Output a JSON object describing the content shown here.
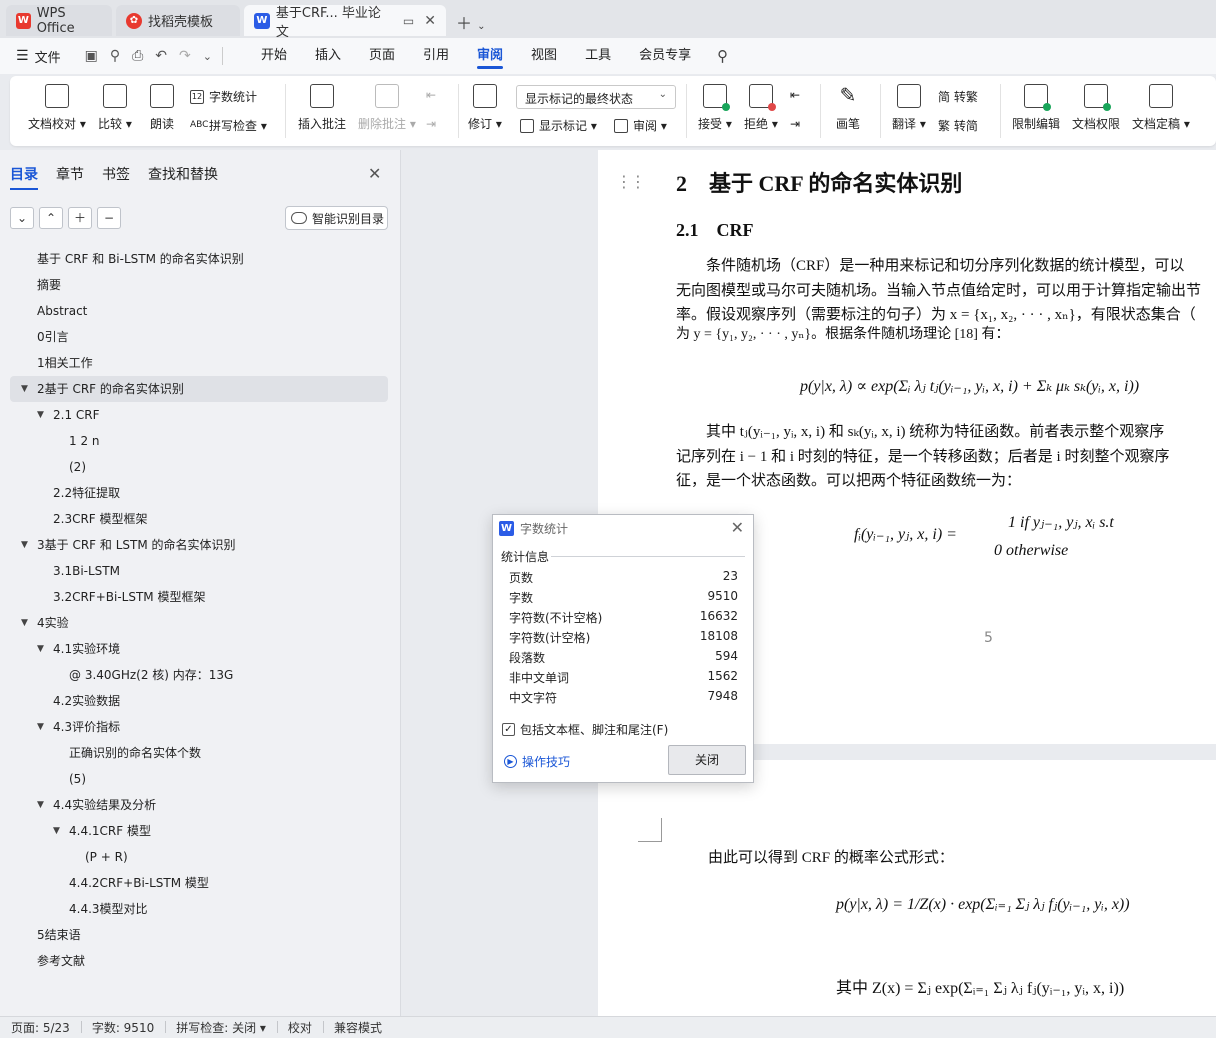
{
  "tabs": [
    {
      "label": "WPS Office",
      "icon": "wps-logo-icon"
    },
    {
      "label": "找稻壳模板",
      "icon": "docer-logo-icon"
    },
    {
      "label": "基于CRF... 毕业论文",
      "icon": "word-doc-icon",
      "active": true
    }
  ],
  "menubar": {
    "file_label": "文件",
    "tabs": [
      "开始",
      "插入",
      "页面",
      "引用",
      "审阅",
      "视图",
      "工具",
      "会员专享"
    ],
    "active_tab": "审阅"
  },
  "ribbon": {
    "doc_check": "文档校对 ▾",
    "compare": "比较 ▾",
    "read_aloud": "朗读",
    "word_count": "字数统计",
    "spell_check": "拼写检查 ▾",
    "insert_comment": "插入批注",
    "delete_comment": "删除批注 ▾",
    "track_changes": "修订 ▾",
    "markup_state": "显示标记的最终状态",
    "show_markup": "显示标记 ▾",
    "review_pane": "审阅 ▾",
    "accept": "接受 ▾",
    "reject": "拒绝 ▾",
    "ink": "画笔",
    "translate": "翻译 ▾",
    "trad_to_simp": "繁 转简",
    "simp_to_trad": "简 转繁",
    "restrict_edit": "限制编辑",
    "doc_permission": "文档权限",
    "finalize": "文档定稿 ▾"
  },
  "nav": {
    "tabs": [
      "目录",
      "章节",
      "书签",
      "查找和替换"
    ],
    "active_tab": "目录",
    "smart_toc": "智能识别目录",
    "toc": [
      {
        "text": "基于 CRF 和 Bi-LSTM 的命名实体识别",
        "level": 0,
        "arrow": ""
      },
      {
        "text": "摘要",
        "level": 0,
        "arrow": ""
      },
      {
        "text": "Abstract",
        "level": 0,
        "arrow": ""
      },
      {
        "text": "0引言",
        "level": 0,
        "arrow": ""
      },
      {
        "text": "1相关工作",
        "level": 0,
        "arrow": ""
      },
      {
        "text": "2基于 CRF 的命名实体识别",
        "level": 0,
        "arrow": "▼",
        "selected": true
      },
      {
        "text": "2.1 CRF",
        "level": 1,
        "arrow": "▼"
      },
      {
        "text": "1 2 n",
        "level": 2,
        "arrow": ""
      },
      {
        "text": "(2)",
        "level": 2,
        "arrow": ""
      },
      {
        "text": "2.2特征提取",
        "level": 1,
        "arrow": ""
      },
      {
        "text": "2.3CRF 模型框架",
        "level": 1,
        "arrow": ""
      },
      {
        "text": "3基于 CRF 和 LSTM 的命名实体识别",
        "level": 0,
        "arrow": "▼"
      },
      {
        "text": "3.1Bi-LSTM",
        "level": 1,
        "arrow": ""
      },
      {
        "text": "3.2CRF+Bi-LSTM 模型框架",
        "level": 1,
        "arrow": ""
      },
      {
        "text": "4实验",
        "level": 0,
        "arrow": "▼"
      },
      {
        "text": "4.1实验环境",
        "level": 1,
        "arrow": "▼"
      },
      {
        "text": "@ 3.40GHz(2 核) 内存：13G",
        "level": 2,
        "arrow": ""
      },
      {
        "text": "4.2实验数据",
        "level": 1,
        "arrow": ""
      },
      {
        "text": "4.3评价指标",
        "level": 1,
        "arrow": "▼"
      },
      {
        "text": "正确识别的命名实体个数",
        "level": 2,
        "arrow": ""
      },
      {
        "text": "(5)",
        "level": 2,
        "arrow": ""
      },
      {
        "text": "4.4实验结果及分析",
        "level": 1,
        "arrow": "▼"
      },
      {
        "text": "4.4.1CRF 模型",
        "level": 2,
        "arrow": "▼"
      },
      {
        "text": "(P + R)",
        "level": 3,
        "arrow": ""
      },
      {
        "text": "4.4.2CRF+Bi-LSTM 模型",
        "level": 2,
        "arrow": ""
      },
      {
        "text": "4.4.3模型对比",
        "level": 2,
        "arrow": ""
      },
      {
        "text": "5结束语",
        "level": 0,
        "arrow": ""
      },
      {
        "text": "参考文献",
        "level": 0,
        "arrow": ""
      }
    ]
  },
  "doc": {
    "heading2": "2　基于 CRF 的命名实体识别",
    "heading3": "2.1　CRF",
    "para1": [
      "　　条件随机场（CRF）是一种用来标记和切分序列化数据的统计模型，可以",
      "无向图模型或马尔可夫随机场。当输入节点值给定时，可以用于计算指定输出节",
      "率。假设观察序列（需要标注的句子）为 x = {x₁, x₂, · · · , xₙ}，有限状态集合（",
      "为 y = {y₁, y₂, · · · , yₙ}。根据条件随机场理论 [18] 有："
    ],
    "eq1": "p(y|x, λ) ∝ exp(Σᵢ λⱼ tⱼ(yᵢ₋₁, yᵢ, x, i) + Σₖ μₖ sₖ(yᵢ, x, i))",
    "para2": [
      "　　其中 tⱼ(yᵢ₋₁, yᵢ, x, i) 和 sₖ(yᵢ, x, i) 统称为特征函数。前者表示整个观察序",
      "记序列在 i − 1 和 i 时刻的特征，是一个转移函数；后者是 i 时刻整个观察序",
      "征，是一个状态函数。可以把两个特征函数统一为："
    ],
    "eq2_lhs": "fᵢ(yᵢ₋₁, yⱼ, x, i) =",
    "eq2_case1": "1 if yⱼ₋₁, yⱼ, xᵢ s.t",
    "eq2_case2": "0  otherwise",
    "page_number": "5",
    "para3": "由此可以得到 CRF 的概率公式形式：",
    "eq3": "p(y|x, λ) = 1/Z(x) · exp(Σᵢ₌₁ Σⱼ λⱼ fⱼ(yᵢ₋₁, yᵢ, x))",
    "eq4": "其中 Z(x) = Σⱼ exp(Σᵢ₌₁ Σⱼ λⱼ fⱼ(yᵢ₋₁, yᵢ, x, i))"
  },
  "dialog": {
    "title": "字数统计",
    "group_label": "统计信息",
    "stats": [
      {
        "label": "页数",
        "value": "23"
      },
      {
        "label": "字数",
        "value": "9510"
      },
      {
        "label": "字符数(不计空格)",
        "value": "16632"
      },
      {
        "label": "字符数(计空格)",
        "value": "18108"
      },
      {
        "label": "段落数",
        "value": "594"
      },
      {
        "label": "非中文单词",
        "value": "1562"
      },
      {
        "label": "中文字符",
        "value": "7948"
      }
    ],
    "include_label": "包括文本框、脚注和尾注(F)",
    "include_checked": true,
    "tips": "操作技巧",
    "close_button": "关闭"
  },
  "status": {
    "page": "页面: 5/23",
    "words": "字数: 9510",
    "spell": "拼写检查: 关闭 ▾",
    "proof": "校对",
    "compat": "兼容模式"
  },
  "colors": {
    "accent": "#1a56d6",
    "wps_red": "#e8392f",
    "word_blue": "#2b5ce6"
  }
}
